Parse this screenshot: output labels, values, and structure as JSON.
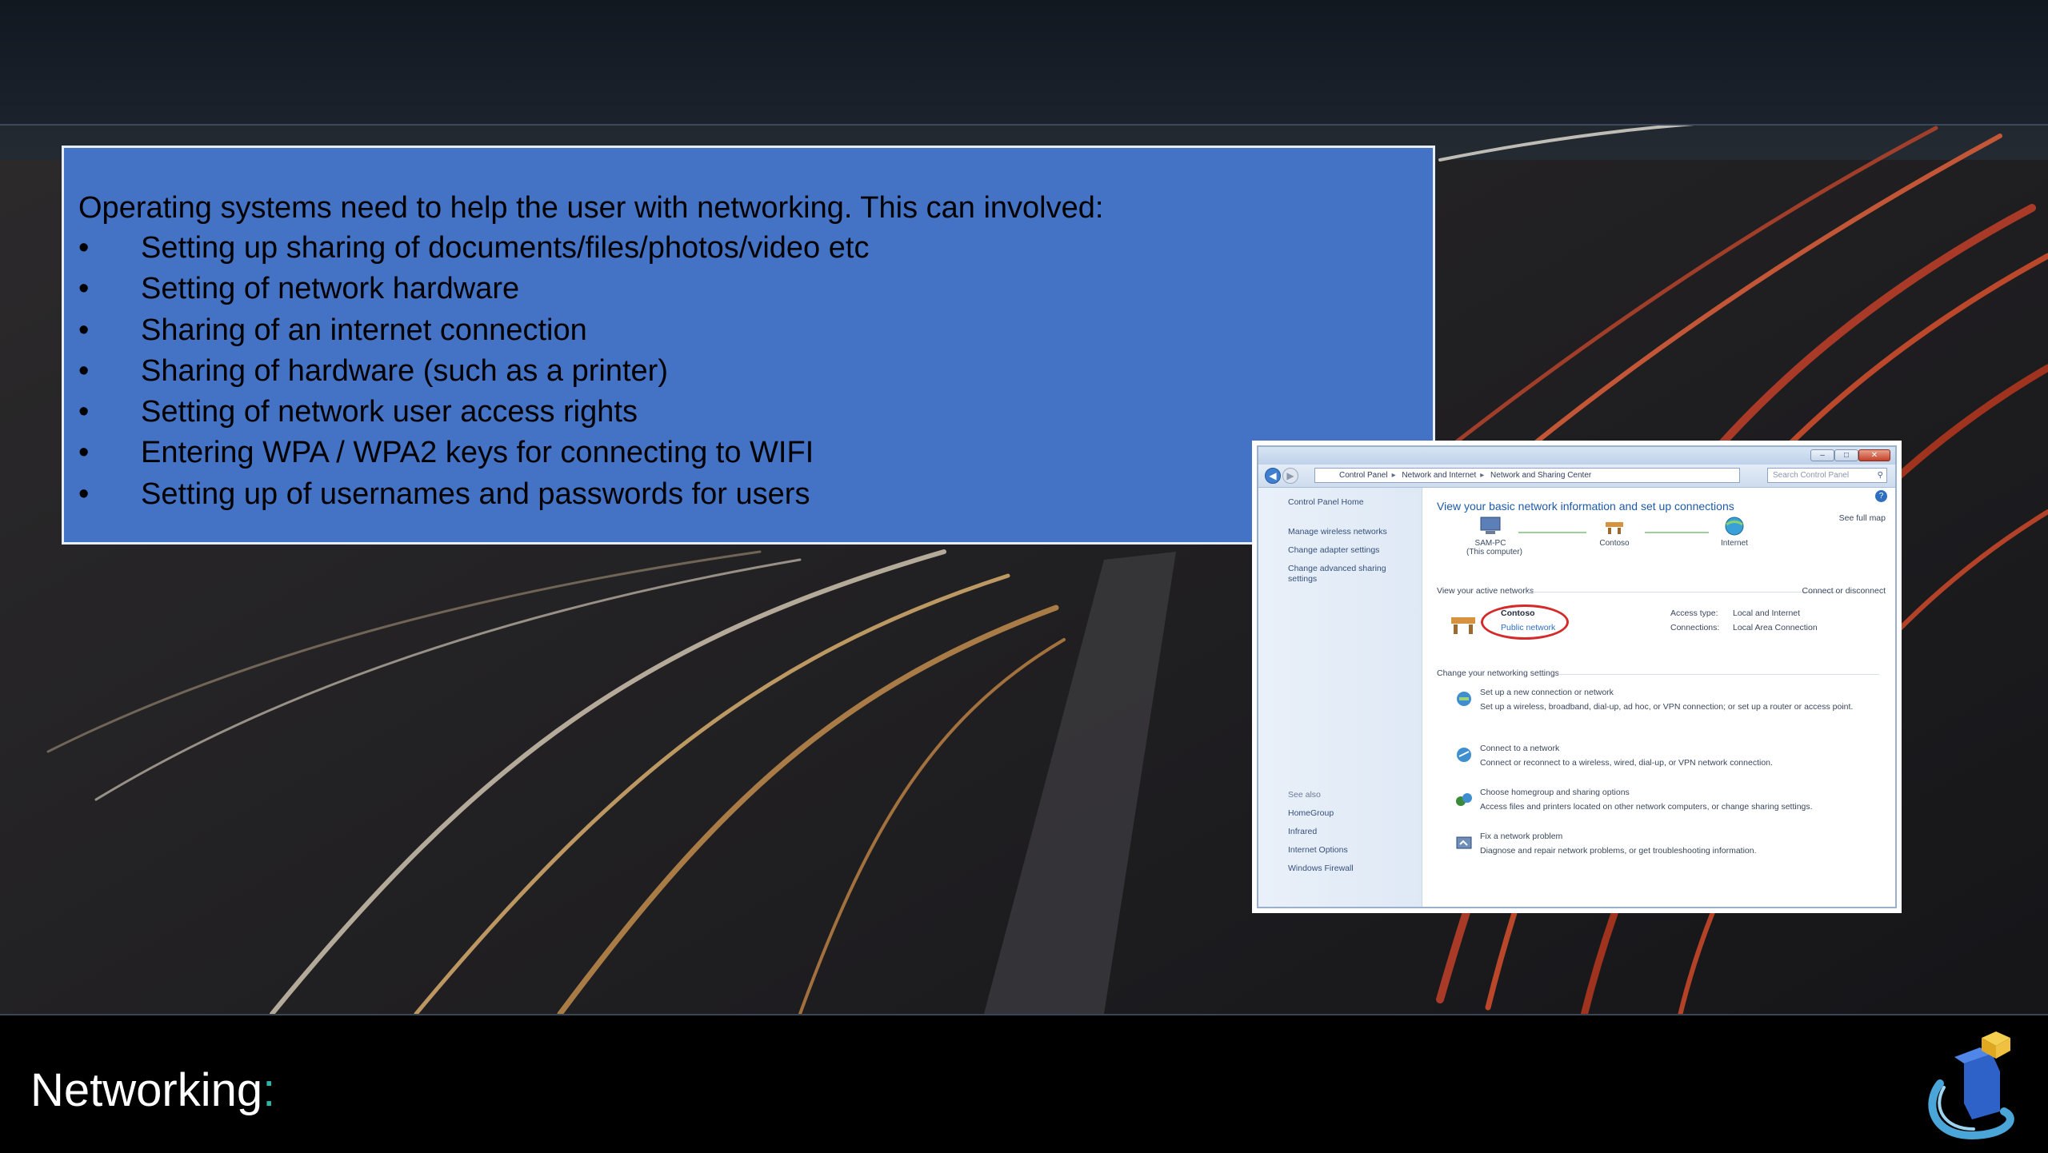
{
  "panel": {
    "intro": "Operating systems need to help the user with networking. This can involved:",
    "bullet_glyph": "•",
    "bullets": [
      "Setting up sharing of documents/files/photos/video etc",
      "Setting of network hardware",
      "Sharing of an internet connection",
      "Sharing of hardware (such as a printer)",
      "Setting of network user access rights",
      "Entering WPA / WPA2 keys for connecting to WIFI",
      "Setting up of usernames and passwords for users"
    ]
  },
  "screenshot": {
    "address": [
      "Control Panel",
      "Network and Internet",
      "Network and Sharing Center"
    ],
    "search_placeholder": "Search Control Panel",
    "sidebar": {
      "home": "Control Panel Home",
      "links": [
        "Manage wireless networks",
        "Change adapter settings",
        "Change advanced sharing settings"
      ],
      "see_also_heading": "See also",
      "see_also": [
        "HomeGroup",
        "Infrared",
        "Internet Options",
        "Windows Firewall"
      ]
    },
    "title": "View your basic network information and set up connections",
    "see_full_map": "See full map",
    "nodes": [
      {
        "name": "SAM-PC",
        "sub": "(This computer)"
      },
      {
        "name": "Contoso",
        "sub": ""
      },
      {
        "name": "Internet",
        "sub": ""
      }
    ],
    "active_networks_heading": "View your active networks",
    "connect_disconnect": "Connect or disconnect",
    "network_name": "Contoso",
    "network_type": "Public network",
    "access_type_label": "Access type:",
    "access_type_value": "Local and Internet",
    "connections_label": "Connections:",
    "connections_value": "Local Area Connection",
    "change_settings_heading": "Change your networking settings",
    "tasks": [
      {
        "link": "Set up a new connection or network",
        "desc": "Set up a wireless, broadband, dial-up, ad hoc, or VPN connection; or set up a router or access point."
      },
      {
        "link": "Connect to a network",
        "desc": "Connect or reconnect to a wireless, wired, dial-up, or VPN network connection."
      },
      {
        "link": "Choose homegroup and sharing options",
        "desc": "Access files and printers located on other network computers, or change sharing settings."
      },
      {
        "link": "Fix a network problem",
        "desc": "Diagnose and repair network problems, or get troubleshooting information."
      }
    ]
  },
  "footer": {
    "title": "Networking",
    "colon": ":"
  },
  "colors": {
    "panel_bg": "#4472c4",
    "title_colon": "#2bb6a8",
    "bottom_bar": "#000000"
  }
}
